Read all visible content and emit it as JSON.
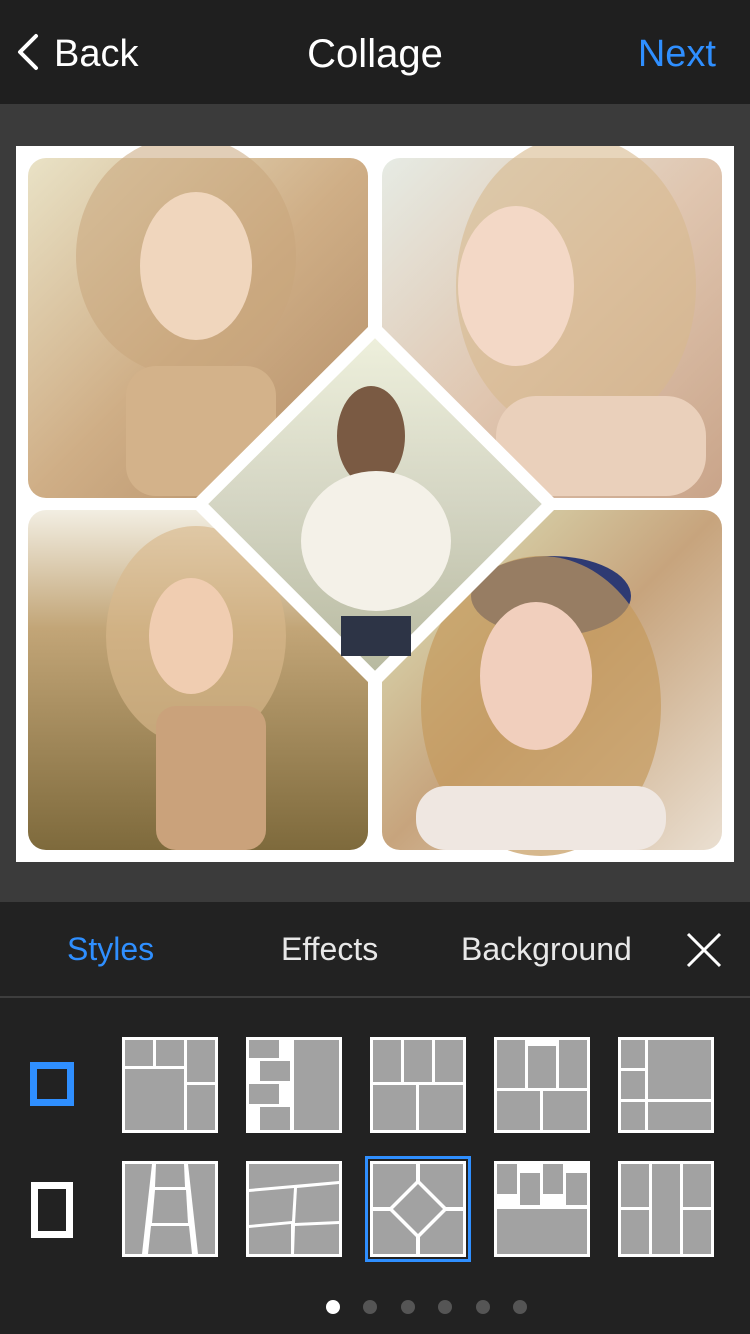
{
  "header": {
    "back_label": "Back",
    "title": "Collage",
    "next_label": "Next"
  },
  "collage": {
    "photos": [
      {
        "name": "photo-top-left"
      },
      {
        "name": "photo-top-right"
      },
      {
        "name": "photo-center-diamond"
      },
      {
        "name": "photo-bottom-left"
      },
      {
        "name": "photo-bottom-right"
      }
    ]
  },
  "panel": {
    "tabs": [
      {
        "label": "Styles",
        "active": true
      },
      {
        "label": "Effects",
        "active": false
      },
      {
        "label": "Background",
        "active": false
      }
    ],
    "close_icon": "close-icon",
    "aspect_ratios": [
      {
        "name": "square-ratio",
        "selected": true
      },
      {
        "name": "portrait-ratio",
        "selected": false
      }
    ],
    "layouts_selected_index": 7,
    "page_count": 6,
    "current_page": 0
  },
  "colors": {
    "accent": "#2f8fff",
    "topbar": "#1f1f1f",
    "panel": "#222222",
    "background": "#3b3b3b"
  }
}
